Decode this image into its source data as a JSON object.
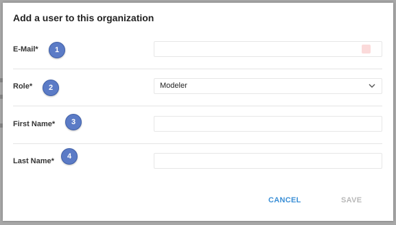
{
  "dialog": {
    "title": "Add a user to this organization"
  },
  "fields": [
    {
      "label": "E-Mail*",
      "value": "",
      "marker": "1"
    },
    {
      "label": "Role*",
      "value": "Modeler",
      "marker": "2"
    },
    {
      "label": "First Name*",
      "value": "",
      "marker": "3"
    },
    {
      "label": "Last Name*",
      "value": "",
      "marker": "4"
    }
  ],
  "buttons": {
    "cancel": "CANCEL",
    "save": "SAVE"
  },
  "colors": {
    "accent": "#3b8fd6",
    "marker": "#5b7bc6",
    "disabled": "#b8b8b8"
  },
  "icons": {
    "role_dropdown": "chevron-down-icon"
  }
}
